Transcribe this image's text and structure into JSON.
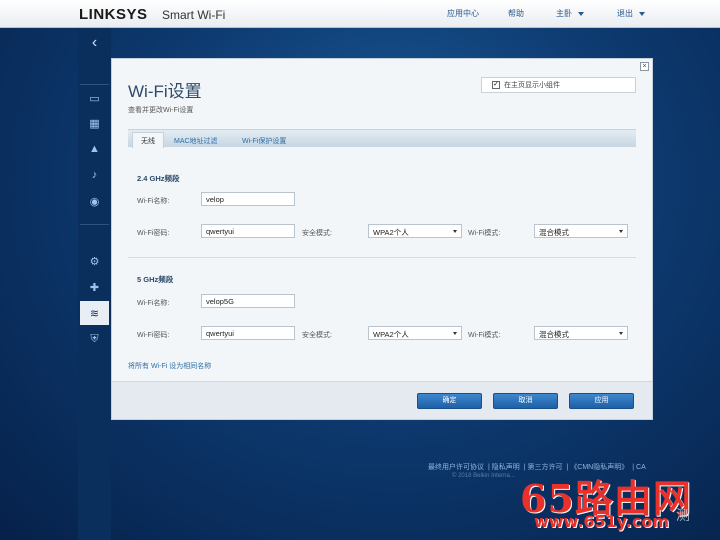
{
  "header": {
    "logo": "LINKSYS",
    "logo_sub": "Smart Wi-Fi",
    "nav": {
      "app_center": "应用中心",
      "help": "帮助",
      "router": "主卧",
      "logout": "退出"
    }
  },
  "sidebar": {
    "icons": [
      "device-list-icon",
      "network-map-icon",
      "alert-icon",
      "parental-controls-icon",
      "speed-test-icon",
      "connectivity-icon",
      "troubleshooting-icon",
      "wifi-icon",
      "security-icon"
    ]
  },
  "dialog": {
    "title": "Wi-Fi设置",
    "subtitle": "查看并更改Wi-Fi设置",
    "widget_label": "在主页显示小组件",
    "widget_checked": true,
    "close_label": "×",
    "tabs": [
      "无线",
      "MAC地址过滤",
      "Wi-Fi保护设置"
    ],
    "band24": {
      "title": "2.4 GHz频段",
      "name_label": "Wi-Fi名称:",
      "name_value": "velop",
      "pwd_label": "Wi-Fi密码:",
      "pwd_value": "qwertyui",
      "security_label": "安全模式:",
      "security_value": "WPA2个人",
      "mode_label": "Wi-Fi模式:",
      "mode_value": "混合模式"
    },
    "band5": {
      "title": "5 GHz频段",
      "name_label": "Wi-Fi名称:",
      "name_value": "velop5G",
      "pwd_label": "Wi-Fi密码:",
      "pwd_value": "qwertyui",
      "security_label": "安全模式:",
      "security_value": "WPA2个人",
      "mode_label": "Wi-Fi模式:",
      "mode_value": "混合模式"
    },
    "same_name_link": "将所有 Wi-Fi 设为相同名称",
    "buttons": {
      "ok": "确定",
      "cancel": "取消",
      "apply": "应用"
    }
  },
  "footer": {
    "links": [
      "最终用户许可协议",
      "隐私声明",
      "第三方许可",
      "《CMN隐私声明》",
      "CA"
    ],
    "copyright": "© 2018 Belkin Interna..."
  },
  "watermark": {
    "text": "65路由网",
    "url": "www.651y.com",
    "corner": "测"
  }
}
